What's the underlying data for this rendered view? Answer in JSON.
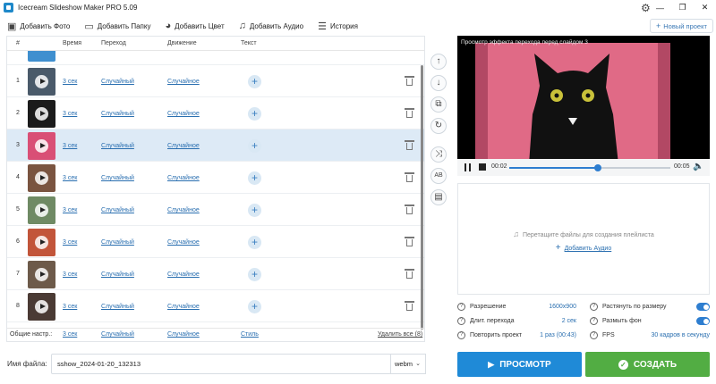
{
  "app": {
    "title": "Icecream Slideshow Maker PRO 5.09"
  },
  "toolbar": {
    "add_photo": "Добавить Фото",
    "add_folder": "Добавить Папку",
    "add_color": "Добавить Цвет",
    "add_audio": "Добавить Аудио",
    "history": "История",
    "new_project": "Новый проект"
  },
  "table": {
    "headers": {
      "num": "#",
      "time": "Время",
      "transition": "Переход",
      "motion": "Движение",
      "text": "Текст"
    },
    "rows": [
      {
        "index": "1",
        "time": "3 сек",
        "transition": "Случайный",
        "motion": "Случайное",
        "thumb_color": "#4a5a6a"
      },
      {
        "index": "2",
        "time": "3 сек",
        "transition": "Случайный",
        "motion": "Случайное",
        "thumb_color": "#1b1b1b"
      },
      {
        "index": "3",
        "time": "3 сек",
        "transition": "Случайный",
        "motion": "Случайное",
        "thumb_color": "#d94f76"
      },
      {
        "index": "4",
        "time": "3 сек",
        "transition": "Случайный",
        "motion": "Случайное",
        "thumb_color": "#7a5440"
      },
      {
        "index": "5",
        "time": "3 сек",
        "transition": "Случайный",
        "motion": "Случайное",
        "thumb_color": "#6f8a64"
      },
      {
        "index": "6",
        "time": "3 сек",
        "transition": "Случайный",
        "motion": "Случайное",
        "thumb_color": "#c2553a"
      },
      {
        "index": "7",
        "time": "3 сек",
        "transition": "Случайный",
        "motion": "Случайное",
        "thumb_color": "#6d5a4a"
      },
      {
        "index": "8",
        "time": "3 сек",
        "transition": "Случайный",
        "motion": "Случайное",
        "thumb_color": "#4a3a34"
      }
    ],
    "footer": {
      "general": "Общие настр.:",
      "time": "3 сек",
      "transition": "Случайный",
      "motion": "Случайное",
      "style": "Стиль",
      "delete_all": "Удалить все (8)"
    }
  },
  "preview": {
    "label": "Просмотр эффекта перехода перед слайдом 3",
    "time_current": "00:02",
    "time_total": "00:05",
    "progress": 0.55
  },
  "playlist": {
    "drop_text": "Перетащите файлы для создания плейлиста",
    "add_audio": "Добавить Аудио"
  },
  "settings": {
    "resolution_label": "Разрешение",
    "resolution_value": "1600x900",
    "transition_duration_label": "Длит. перехода",
    "transition_duration_value": "2 сек",
    "repeat_label": "Повторить проект",
    "repeat_value": "1 раз (00:43)",
    "stretch_label": "Растянуть по размеру",
    "blur_label": "Размыть фон",
    "fps_label": "FPS",
    "fps_value": "30 кадров в секунду"
  },
  "output": {
    "filename_label": "Имя файла:",
    "filename_value": "sshow_2024-01-20_132313",
    "format": "webm"
  },
  "buttons": {
    "preview": "ПРОСМОТР",
    "create": "СОЗДАТЬ"
  },
  "colors": {
    "accent": "#1f8ad7",
    "create": "#52ad43",
    "selected_row": "#ddeaf6",
    "preview_bg": "#e06a86"
  }
}
